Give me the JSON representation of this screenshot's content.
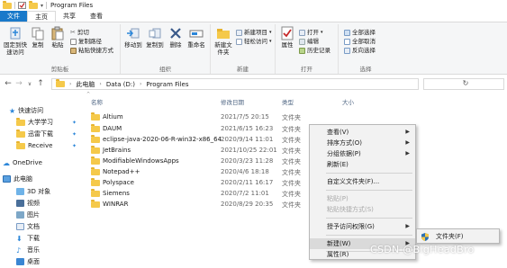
{
  "titlebar": {
    "title": "Program Files"
  },
  "tabs": [
    {
      "label": "文件"
    },
    {
      "label": "主页"
    },
    {
      "label": "共享"
    },
    {
      "label": "查看"
    }
  ],
  "ribbon": {
    "clipboard": {
      "label": "剪贴板",
      "pin": "固定到快速访问",
      "copy": "复制",
      "paste": "粘贴",
      "cut": "剪切",
      "copy_path": "复制路径",
      "paste_shortcut": "粘贴快捷方式"
    },
    "organize": {
      "label": "组织",
      "move_to": "移动到",
      "copy_to": "复制到",
      "delete": "删除",
      "rename": "重命名"
    },
    "new": {
      "label": "新建",
      "new_folder": "新建文件夹",
      "new_item": "新建项目",
      "easy_access": "轻松访问"
    },
    "open": {
      "label": "打开",
      "properties": "属性",
      "open": "打开",
      "edit": "编辑",
      "history": "历史记录"
    },
    "select": {
      "label": "选择",
      "select_all": "全部选择",
      "select_none": "全部取消",
      "invert": "反向选择"
    }
  },
  "address": {
    "crumbs": [
      "此电脑",
      "Data (D:)",
      "Program Files"
    ]
  },
  "navpane": {
    "items": [
      {
        "label": "快速访问",
        "icon": "star-icon"
      },
      {
        "label": "大学学习",
        "icon": "folder-icon"
      },
      {
        "label": "迅雷下载",
        "icon": "folder-icon"
      },
      {
        "label": "Receive",
        "icon": "folder-icon"
      },
      {
        "label": "OneDrive",
        "icon": "cloud-icon"
      },
      {
        "label": "此电脑",
        "icon": "computer-icon"
      },
      {
        "label": "3D 对象",
        "icon": "cube-icon"
      },
      {
        "label": "视频",
        "icon": "video-icon"
      },
      {
        "label": "图片",
        "icon": "picture-icon"
      },
      {
        "label": "文档",
        "icon": "document-icon"
      },
      {
        "label": "下载",
        "icon": "download-icon"
      },
      {
        "label": "音乐",
        "icon": "music-icon"
      },
      {
        "label": "桌面",
        "icon": "desktop-icon"
      }
    ]
  },
  "filelist": {
    "columns": {
      "name": "名称",
      "date": "修改日期",
      "type": "类型",
      "size": "大小"
    },
    "rows": [
      {
        "name": "Altium",
        "date": "2021/7/5 20:15",
        "type": "文件夹"
      },
      {
        "name": "DAUM",
        "date": "2021/6/15 16:23",
        "type": "文件夹"
      },
      {
        "name": "eclipse-java-2020-06-R-win32-x86_64",
        "date": "2020/9/14 11:01",
        "type": "文件夹"
      },
      {
        "name": "JetBrains",
        "date": "2021/10/25 22:01",
        "type": "文件夹"
      },
      {
        "name": "ModifiableWindowsApps",
        "date": "2020/3/23 11:28",
        "type": "文件夹"
      },
      {
        "name": "Notepad++",
        "date": "2020/4/6 18:18",
        "type": "文件夹"
      },
      {
        "name": "Polyspace",
        "date": "2020/2/11 16:17",
        "type": "文件夹"
      },
      {
        "name": "Siemens",
        "date": "2020/7/2 11:01",
        "type": "文件夹"
      },
      {
        "name": "WINRAR",
        "date": "2020/8/29 20:35",
        "type": "文件夹"
      }
    ]
  },
  "context_menu": {
    "items": [
      {
        "label": "查看(V)",
        "submenu": true,
        "disabled": false
      },
      {
        "label": "排序方式(O)",
        "submenu": true,
        "disabled": false
      },
      {
        "label": "分组依据(P)",
        "submenu": true,
        "disabled": false
      },
      {
        "label": "刷新(E)",
        "submenu": false,
        "disabled": false
      },
      {
        "label": "自定义文件夹(F)...",
        "submenu": false,
        "disabled": false
      },
      {
        "label": "粘贴(P)",
        "submenu": false,
        "disabled": true
      },
      {
        "label": "粘贴快捷方式(S)",
        "submenu": false,
        "disabled": true
      },
      {
        "label": "授予访问权限(G)",
        "submenu": true,
        "disabled": false
      },
      {
        "label": "新建(W)",
        "submenu": true,
        "disabled": false,
        "highlighted": true
      },
      {
        "label": "属性(R)",
        "submenu": false,
        "disabled": false
      }
    ]
  },
  "submenu": {
    "label": "文件夹(F)"
  },
  "watermark": "CSDN @BigHeadBro",
  "colors": {
    "accent": "#1979ca",
    "folder": "#f5c94a",
    "pin": "#2b86d9"
  }
}
